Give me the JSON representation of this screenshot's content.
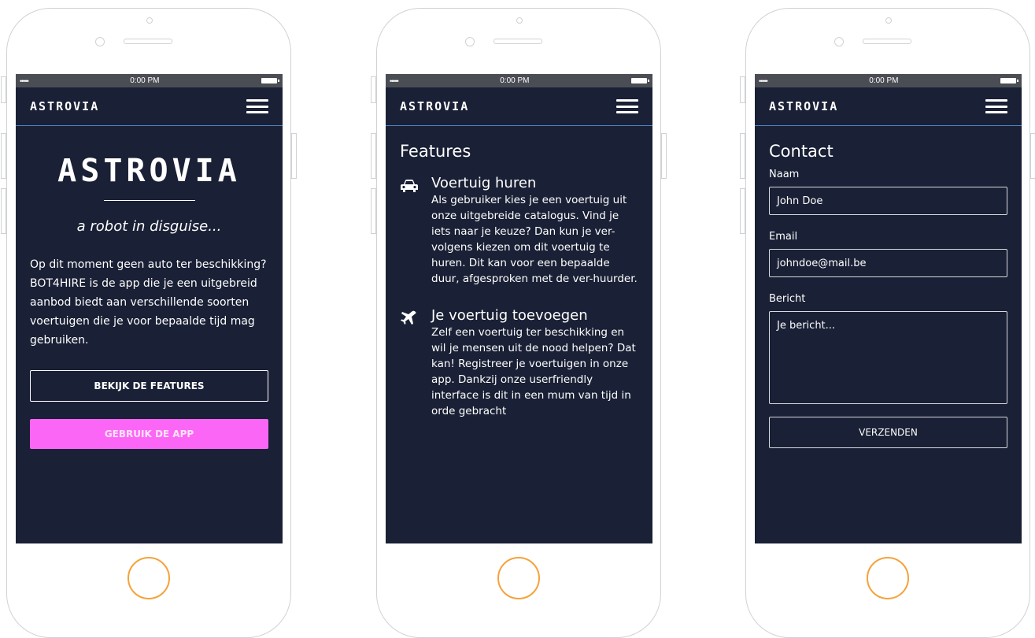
{
  "statusbar": {
    "signal": "•••••",
    "time": "0:00 PM"
  },
  "brand": "ASTROVIA",
  "home": {
    "title": "ASTROVIA",
    "tagline": "a robot in disguise...",
    "intro": "Op dit moment geen auto ter beschikking? BOT4HIRE is de app die je een uitgebreid aanbod biedt aan verschillende soorten voertuigen die je voor bepaalde tijd mag gebruiken.",
    "features_button": "BEKIJK DE FEATURES",
    "app_button": "GEBRUIK DE APP"
  },
  "features": {
    "title": "Features",
    "items": [
      {
        "icon": "car-icon",
        "heading": "Voertuig huren",
        "text": "Als gebruiker kies je een voertuig uit onze uitgebreide catalogus. Vind je iets naar je keuze? Dan kun je ver-volgens kiezen om dit voertuig te huren. Dit kan voor een bepaalde duur, afgesproken met de ver-huurder."
      },
      {
        "icon": "plane-icon",
        "heading": "Je voertuig toevoegen",
        "text": "Zelf een voertuig ter beschikking en wil je mensen uit de nood helpen? Dat kan! Registreer je voertuigen in onze app. Dankzij onze userfriendly interface is dit in een mum van tijd in orde gebracht"
      }
    ]
  },
  "contact": {
    "title": "Contact",
    "name_label": "Naam",
    "name_value": "John Doe",
    "email_label": "Email",
    "email_value": "johndoe@mail.be",
    "message_label": "Bericht",
    "message_placeholder": "Je bericht...",
    "submit": "VERZENDEN"
  },
  "colors": {
    "screen_bg": "#1a2035",
    "accent_pink": "#fc66f6",
    "nav_border": "#4f84c4",
    "home_button": "#f5a23a"
  }
}
